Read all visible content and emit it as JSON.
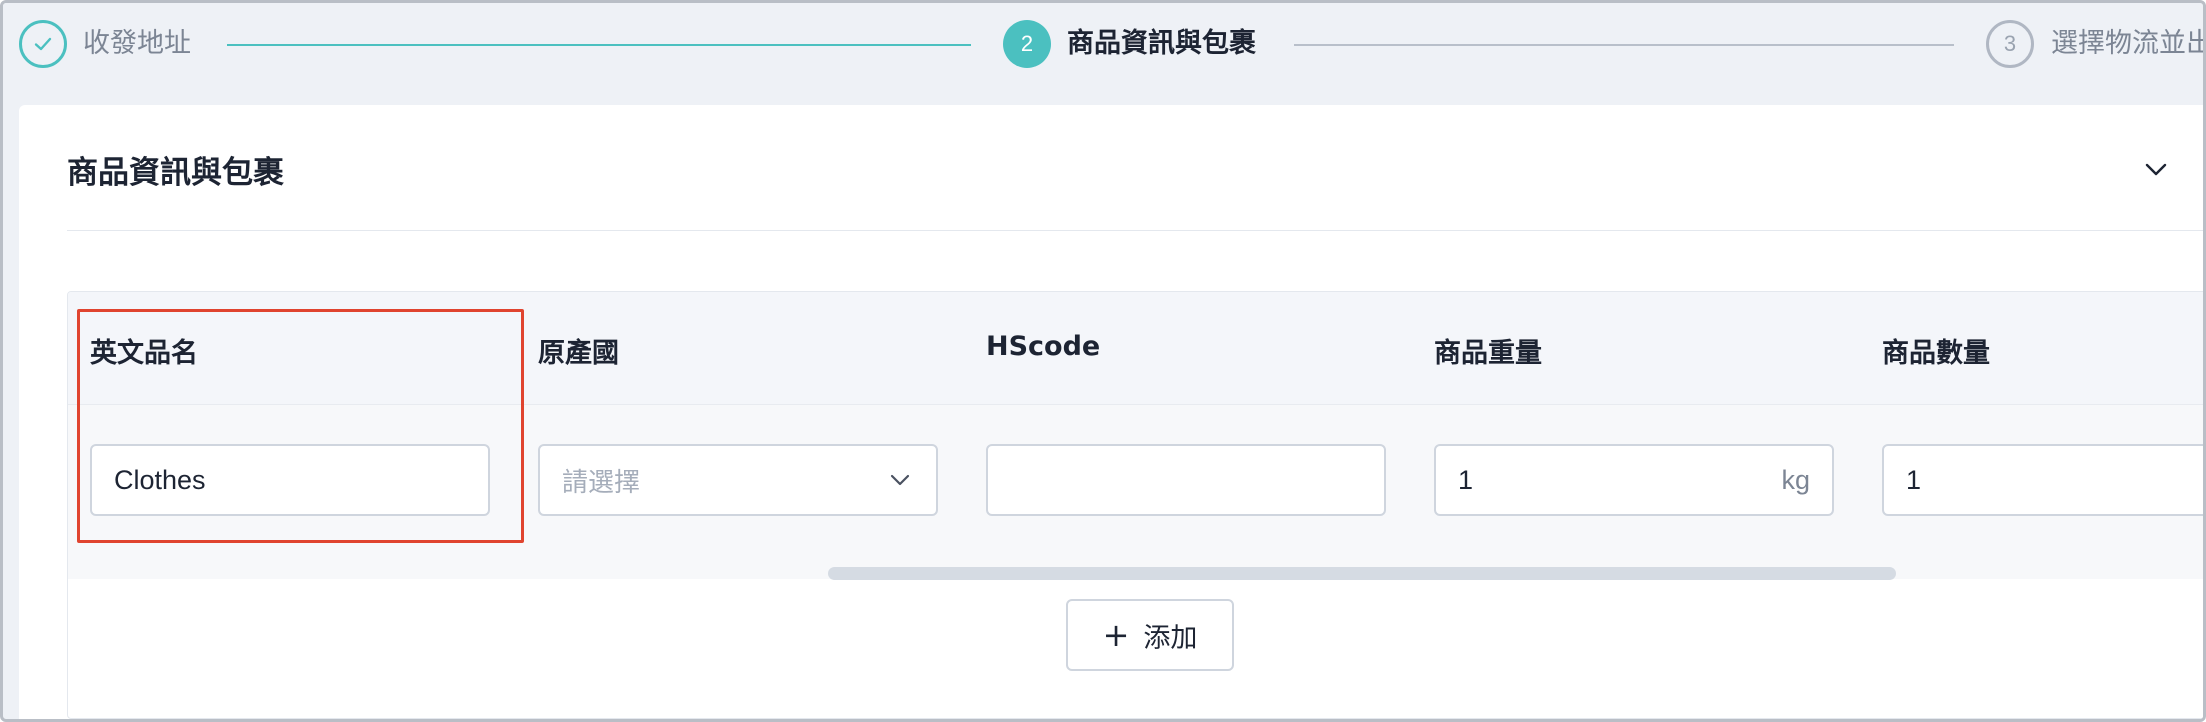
{
  "stepper": {
    "steps": [
      {
        "number": "1",
        "label": "收發地址",
        "state": "done"
      },
      {
        "number": "2",
        "label": "商品資訊與包裹",
        "state": "active"
      },
      {
        "number": "3",
        "label": "選擇物流並出",
        "state": "pending"
      }
    ],
    "accent_color": "#4bc0c0",
    "done_icon": "check-icon"
  },
  "card": {
    "title": "商品資訊與包裹",
    "collapse_icon": "chevron-down-icon"
  },
  "table": {
    "columns": [
      "英文品名",
      "原產國",
      "HScode",
      "商品重量",
      "商品數量"
    ],
    "rows": [
      {
        "english_name": {
          "value": "Clothes",
          "placeholder": ""
        },
        "origin_country": {
          "value": "",
          "placeholder": "請選擇"
        },
        "hscode": {
          "value": "",
          "placeholder": ""
        },
        "weight": {
          "value": "1",
          "unit": "kg"
        },
        "quantity": {
          "value": "1"
        }
      }
    ]
  },
  "add_button": {
    "label": "添加",
    "icon": "plus-icon"
  },
  "highlight_color": "#e0442f"
}
